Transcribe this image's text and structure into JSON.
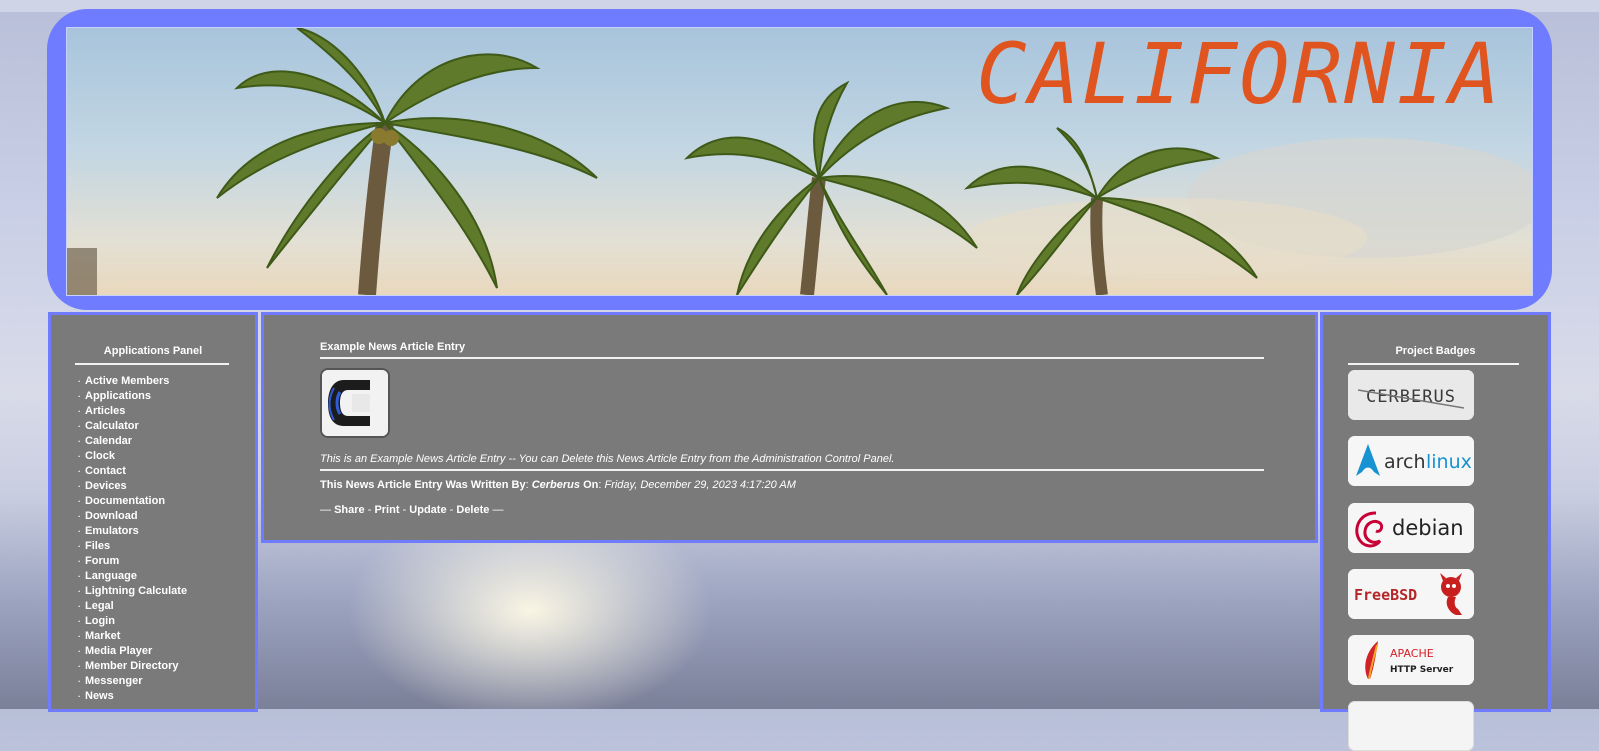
{
  "header": {
    "banner_title": "CALIFORNIA"
  },
  "left_panel": {
    "title": "Applications Panel",
    "items": [
      "Active Members",
      "Applications",
      "Articles",
      "Calculator",
      "Calendar",
      "Clock",
      "Contact",
      "Devices",
      "Documentation",
      "Download",
      "Emulators",
      "Files",
      "Forum",
      "Language",
      "Lightning Calculate",
      "Legal",
      "Login",
      "Market",
      "Media Player",
      "Member Directory",
      "Messenger",
      "News"
    ],
    "bullet": "·"
  },
  "article": {
    "title": "Example News Article Entry",
    "logo_icon": "cerberus-logo-icon",
    "body": "This is an Example News Article Entry -- You can Delete this News Article Entry from the Administration Control Panel.",
    "written_by_label": "This News Article Entry Was Written By",
    "author": "Cerberus",
    "on_label": "On",
    "date": "Friday, December 29, 2023 4:17:20 AM",
    "actions": {
      "lead": "—",
      "share": "Share",
      "print": "Print",
      "update": "Update",
      "delete": "Delete",
      "sep": "-",
      "trail": "—"
    }
  },
  "right_panel": {
    "title": "Project Badges",
    "badges": {
      "cerberus": "CERBERUS",
      "arch_a": "arch",
      "arch_b": "linux",
      "debian": "debian",
      "freebsd": "FreeBSD",
      "apache_a": "APACHE",
      "apache_b": "HTTP Server"
    }
  },
  "colors": {
    "frame_blue": "#6f7cff",
    "panel_gray": "#7a7a7a",
    "banner_text": "#e0541f"
  }
}
